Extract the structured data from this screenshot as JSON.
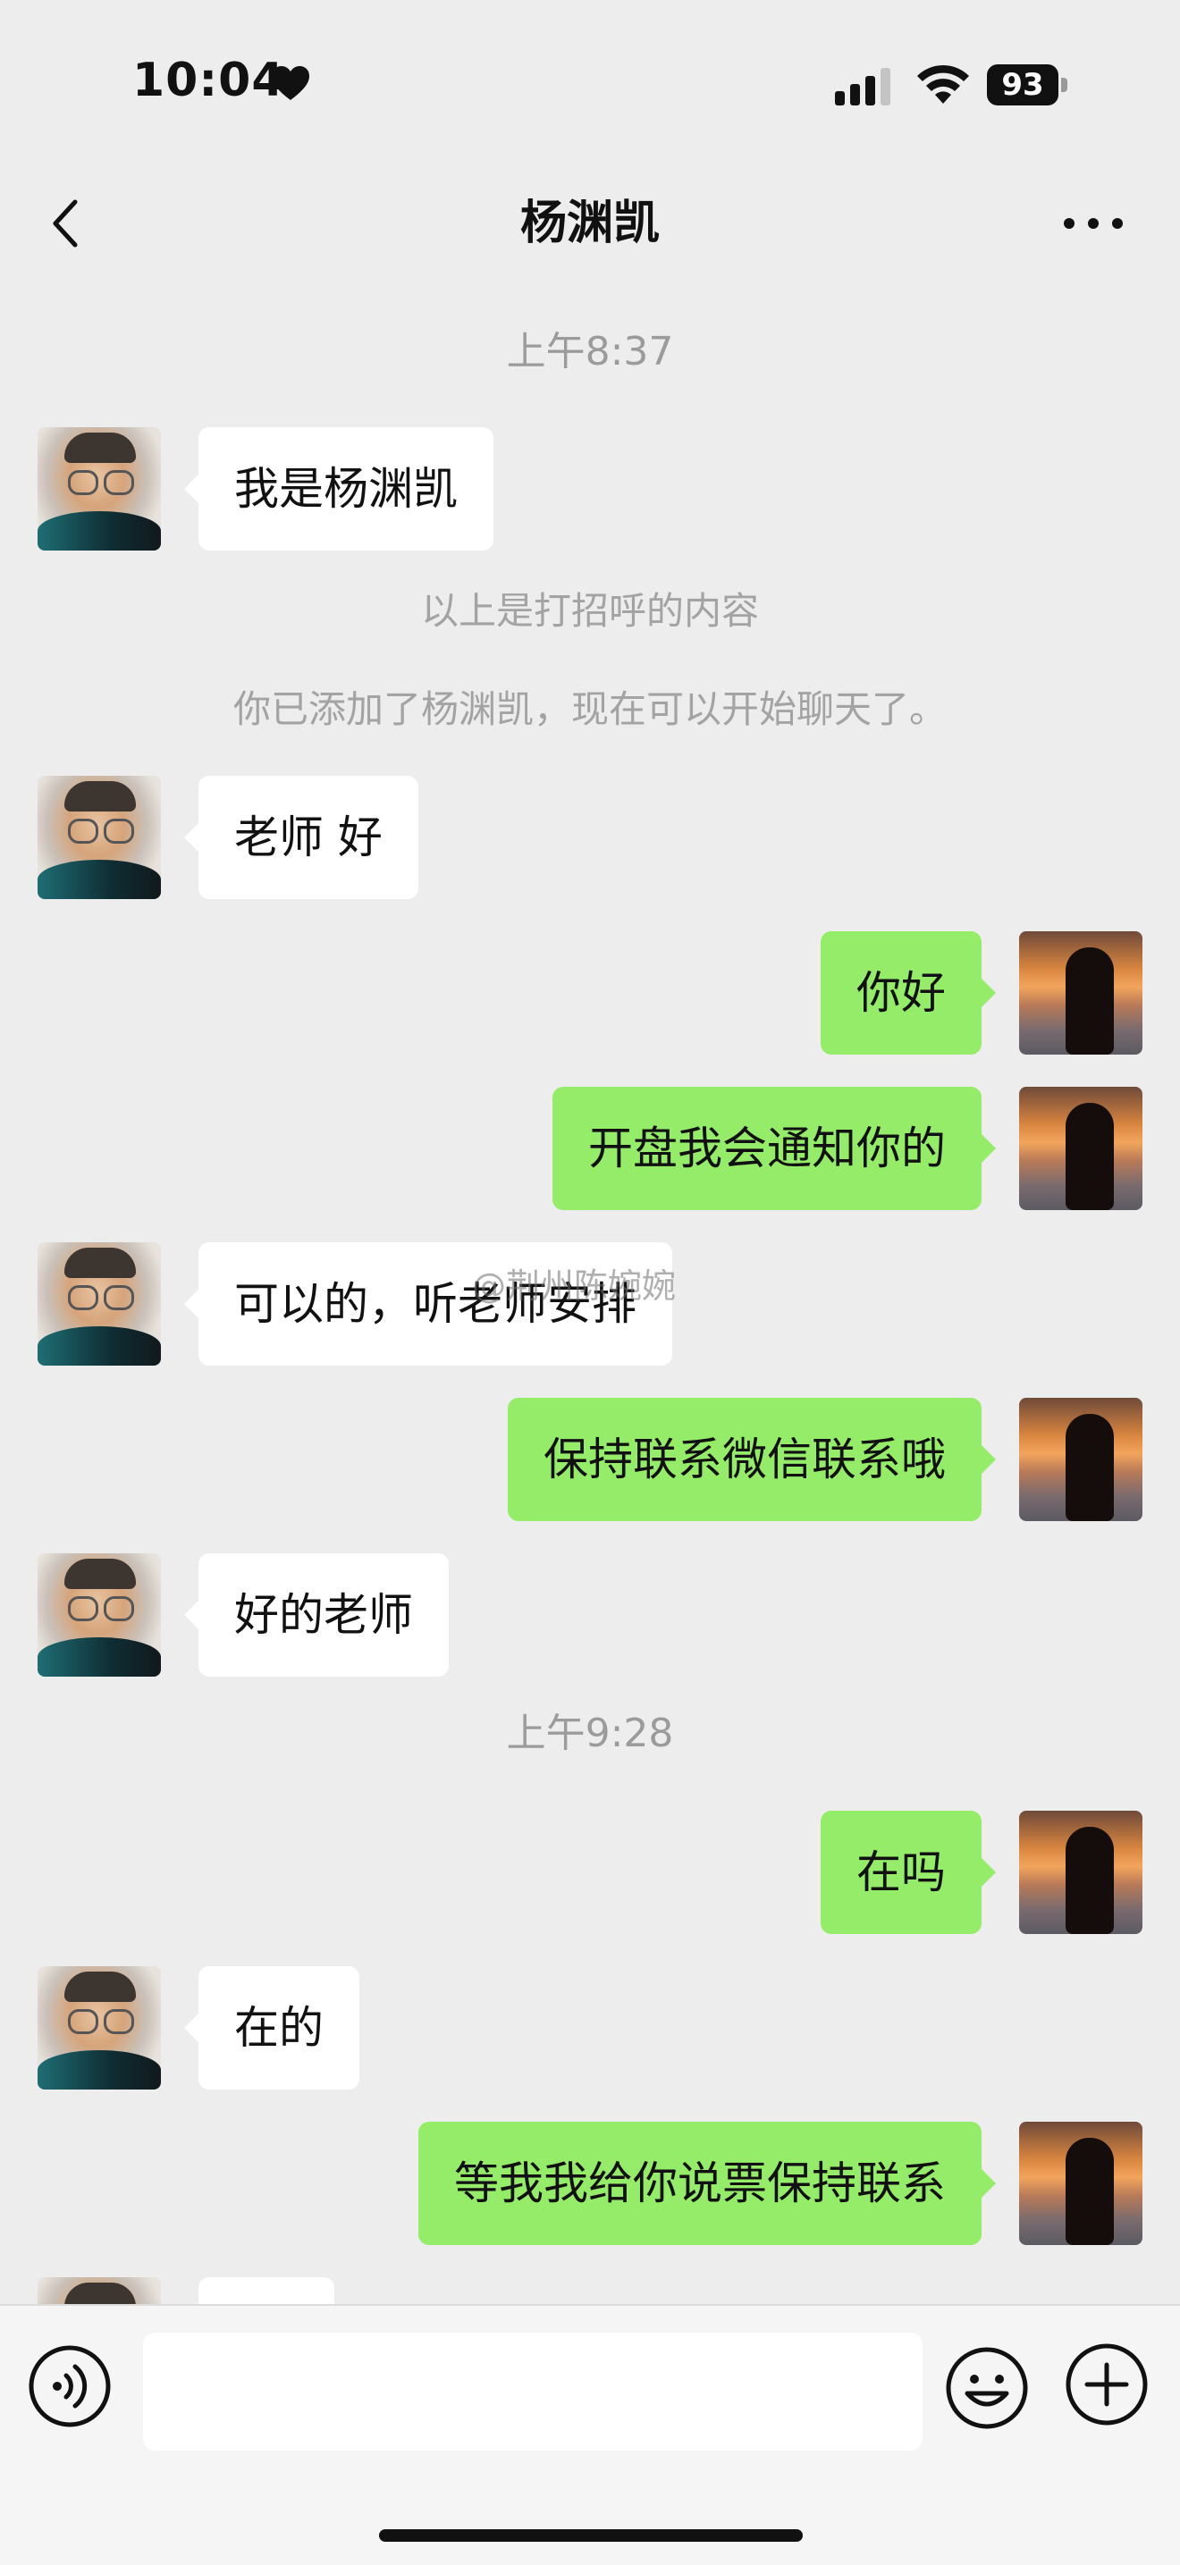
{
  "status": {
    "time": "10:04",
    "battery": "93"
  },
  "nav": {
    "title": "杨渊凯"
  },
  "chat": {
    "time_1": "上午8:37",
    "msg_1": "我是杨渊凯",
    "sys_1": "以上是打招呼的内容",
    "sys_2": "你已添加了杨渊凯，现在可以开始聊天了。",
    "msg_2": "老师 好",
    "msg_3": "你好",
    "msg_4": "开盘我会通知你的",
    "msg_5": "可以的，听老师安排",
    "msg_6": "保持联系微信联系哦",
    "msg_7": "好的老师",
    "time_2": "上午9:28",
    "msg_8": "在吗",
    "msg_9": "在的",
    "msg_10": "等我我给你说票保持联系",
    "watermark": "@荆州陈婉婉"
  },
  "colors": {
    "background": "#ededed",
    "outgoing_bubble": "#95ec69",
    "incoming_bubble": "#ffffff"
  },
  "icons": [
    "back-icon",
    "more-icon",
    "heart-icon",
    "signal-icon",
    "wifi-icon",
    "battery-icon",
    "voice-icon",
    "emoji-icon",
    "plus-icon"
  ]
}
